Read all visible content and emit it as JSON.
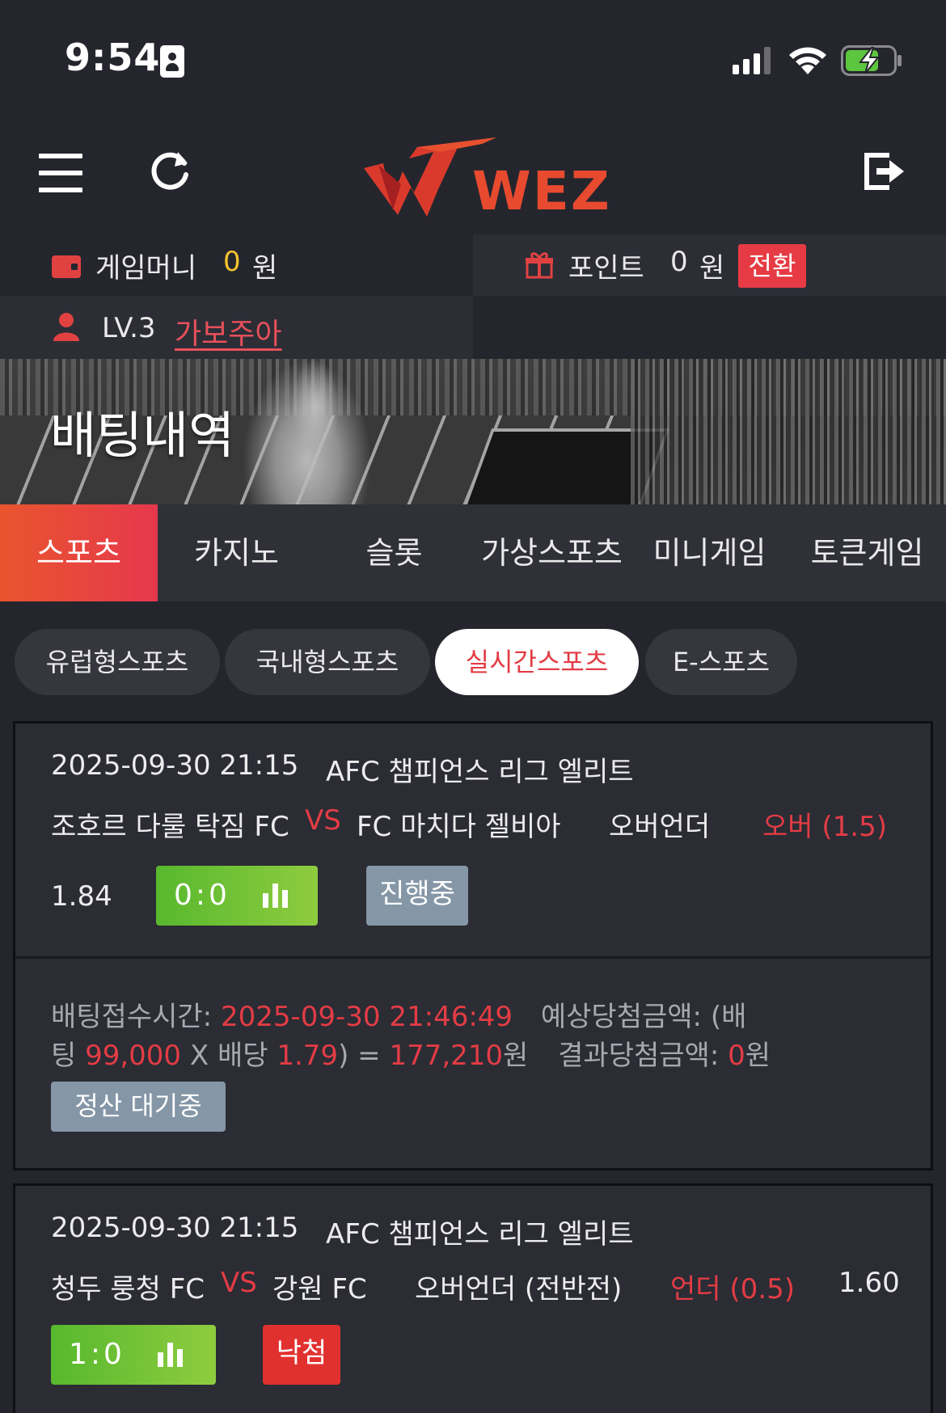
{
  "status_bar": {
    "time": "9:54"
  },
  "header": {
    "logo_text": "WEZ",
    "icons": [
      "menu-icon",
      "refresh-icon",
      "logout-icon"
    ]
  },
  "wallet": {
    "money_label": "게임머니",
    "money_value": "0",
    "money_unit": "원",
    "point_label": "포인트",
    "point_value": "0",
    "point_unit": "원",
    "convert_label": "전환"
  },
  "user": {
    "level": "LV.3",
    "name": "가보주아"
  },
  "banner": {
    "title": "배팅내역"
  },
  "main_tabs": [
    {
      "label": "스포츠",
      "active": true
    },
    {
      "label": "카지노",
      "active": false
    },
    {
      "label": "슬롯",
      "active": false
    },
    {
      "label": "가상스포츠",
      "active": false
    },
    {
      "label": "미니게임",
      "active": false
    },
    {
      "label": "토큰게임",
      "active": false
    }
  ],
  "sub_tabs": [
    {
      "label": "유럽형스포츠",
      "active": false
    },
    {
      "label": "국내형스포츠",
      "active": false
    },
    {
      "label": "실시간스포츠",
      "active": true
    },
    {
      "label": "E-스포츠",
      "active": false
    }
  ],
  "bets": [
    {
      "datetime": "2025-09-30 21:15",
      "league": "AFC 챔피언스 리그 엘리트",
      "home": "조호르 다룰 탁짐 FC",
      "vs": "VS",
      "away": "FC 마치다 젤비아",
      "market": "오버언더",
      "pick": "오버 (1.5)",
      "odds": "1.84",
      "score": "0:0",
      "status": "진행중",
      "receipt_label": "배팅접수시간:",
      "receipt_time": "2025-09-30 21:46:49",
      "expected_label": "예상당첨금액: (배",
      "expected_label_cont": "팅",
      "stake": "99,000",
      "x_label": "X 배당",
      "total_odds": "1.79",
      "close_paren": ") =",
      "expected_amount": "177,210",
      "won_unit": "원",
      "result_label": "결과당첨금액:",
      "result_amount": "0",
      "result_unit": "원",
      "settle_status": "정산 대기중"
    },
    {
      "datetime": "2025-09-30 21:15",
      "league": "AFC 챔피언스 리그 엘리트",
      "home": "청두 룽청 FC",
      "vs": "VS",
      "away": "강원 FC",
      "market": "오버언더 (전반전)",
      "pick": "언더 (0.5)",
      "odds": "1.60",
      "score": "1:0",
      "status": "낙첨"
    }
  ],
  "colors": {
    "background": "#25262d",
    "accent_red": "#e33c45",
    "active_tab_gradient_start": "#e9552e",
    "active_tab_gradient_end": "#e6384d",
    "score_green": "#6cc036",
    "badge_gray": "#8596a7",
    "gold": "#f2c230"
  }
}
